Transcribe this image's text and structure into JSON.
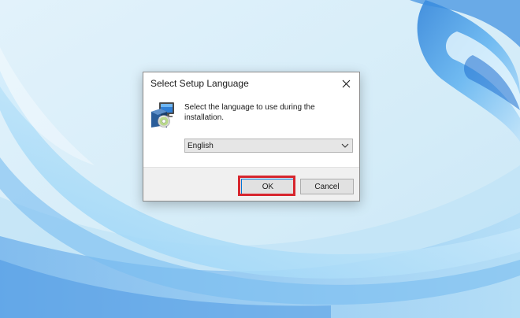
{
  "dialog": {
    "title": "Select Setup Language",
    "message": "Select the language to use during the installation.",
    "language_select": {
      "selected": "English"
    },
    "ok_label": "OK",
    "cancel_label": "Cancel"
  },
  "colors": {
    "highlight": "#d7262e",
    "accent": "#0078d7"
  },
  "icons": {
    "close": "close-icon",
    "app": "setup-computer-icon",
    "dropdown": "chevron-down-icon"
  }
}
